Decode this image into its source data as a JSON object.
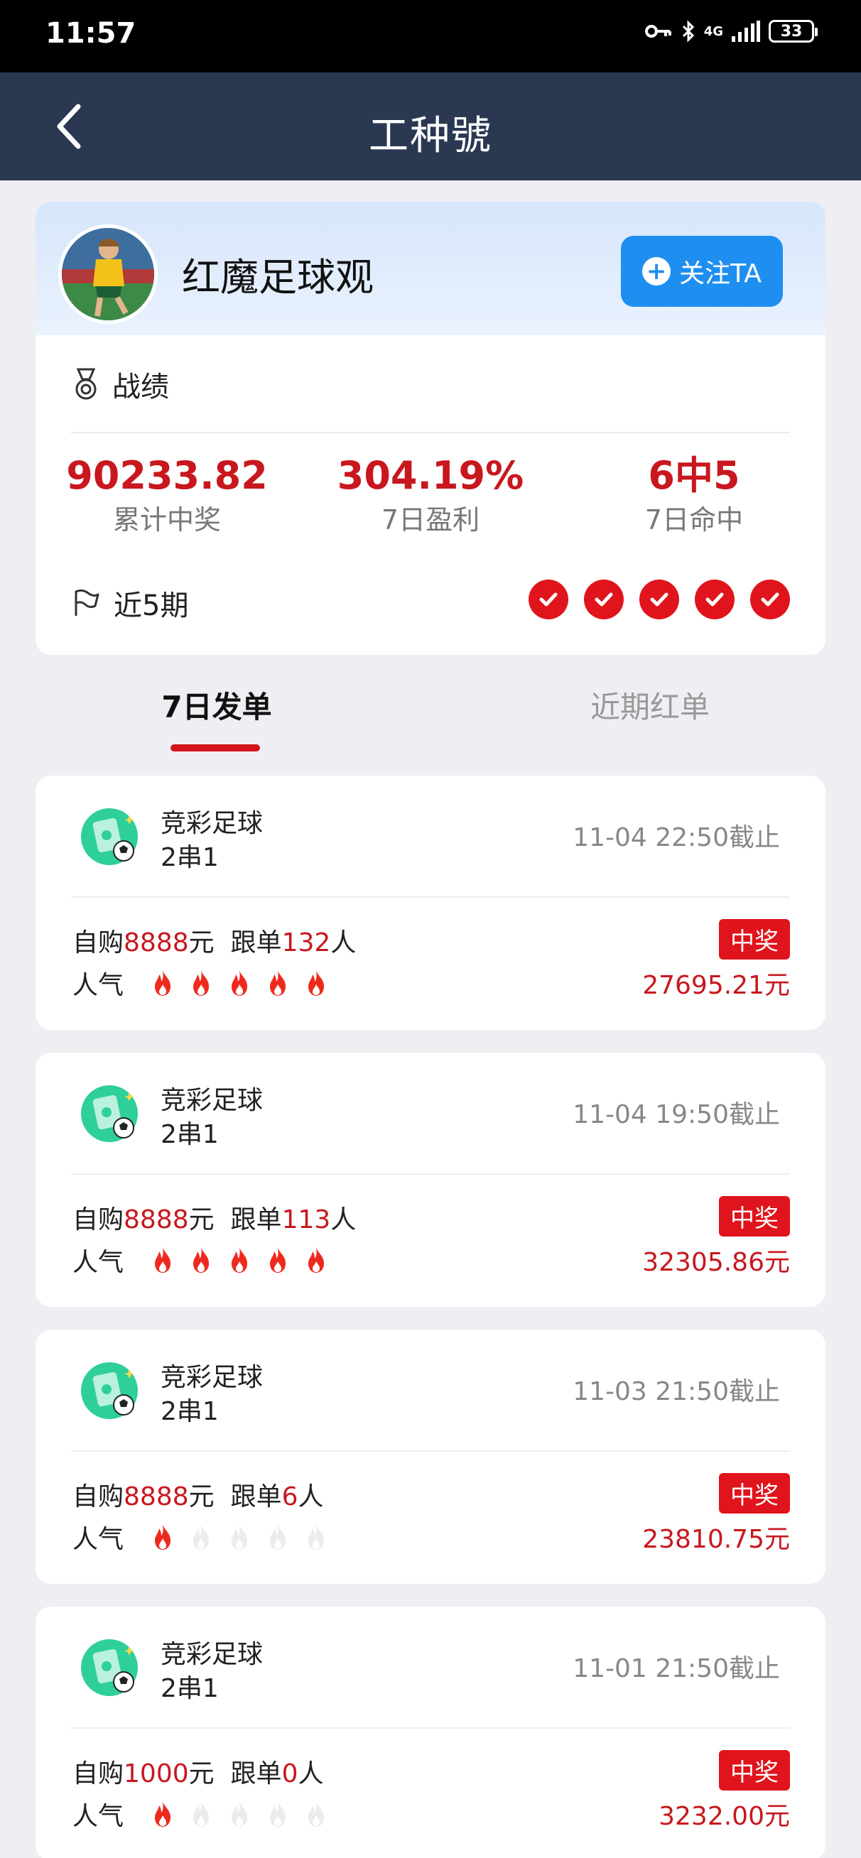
{
  "status_bar": {
    "time": "11:57",
    "network": "4G",
    "battery": "33"
  },
  "nav": {
    "title": "工种號"
  },
  "profile": {
    "name": "红魔足球观",
    "follow_label": "关注TA"
  },
  "record": {
    "title": "战绩",
    "stats": [
      {
        "value": "90233.82",
        "label": "累计中奖"
      },
      {
        "value": "304.19%",
        "label": "7日盈利"
      },
      {
        "value": "6中5",
        "label": "7日命中"
      }
    ],
    "recent_label": "近5期",
    "recent_results": [
      "win",
      "win",
      "win",
      "win",
      "win"
    ]
  },
  "tabs": [
    {
      "label": "7日发单",
      "active": true
    },
    {
      "label": "近期红单",
      "active": false
    }
  ],
  "orders": [
    {
      "game": "竞彩足球",
      "type": "2串1",
      "deadline": "11-04 22:50截止",
      "buy_prefix": "自购",
      "buy_amount": "8888",
      "buy_unit": "元",
      "follow_prefix": "跟单",
      "follow_count": "132",
      "follow_unit": "人",
      "popularity_label": "人气",
      "popularity": 5,
      "badge": "中奖",
      "prize": "27695.21元"
    },
    {
      "game": "竞彩足球",
      "type": "2串1",
      "deadline": "11-04 19:50截止",
      "buy_prefix": "自购",
      "buy_amount": "8888",
      "buy_unit": "元",
      "follow_prefix": "跟单",
      "follow_count": "113",
      "follow_unit": "人",
      "popularity_label": "人气",
      "popularity": 5,
      "badge": "中奖",
      "prize": "32305.86元"
    },
    {
      "game": "竞彩足球",
      "type": "2串1",
      "deadline": "11-03 21:50截止",
      "buy_prefix": "自购",
      "buy_amount": "8888",
      "buy_unit": "元",
      "follow_prefix": "跟单",
      "follow_count": "6",
      "follow_unit": "人",
      "popularity_label": "人气",
      "popularity": 1,
      "badge": "中奖",
      "prize": "23810.75元"
    },
    {
      "game": "竞彩足球",
      "type": "2串1",
      "deadline": "11-01 21:50截止",
      "buy_prefix": "自购",
      "buy_amount": "1000",
      "buy_unit": "元",
      "follow_prefix": "跟单",
      "follow_count": "0",
      "follow_unit": "人",
      "popularity_label": "人气",
      "popularity": 1,
      "badge": "中奖",
      "prize": "3232.00元"
    }
  ],
  "colors": {
    "accent_red": "#e0141c",
    "nav_bg": "#2a3852",
    "follow_blue": "#1e8ff0"
  }
}
